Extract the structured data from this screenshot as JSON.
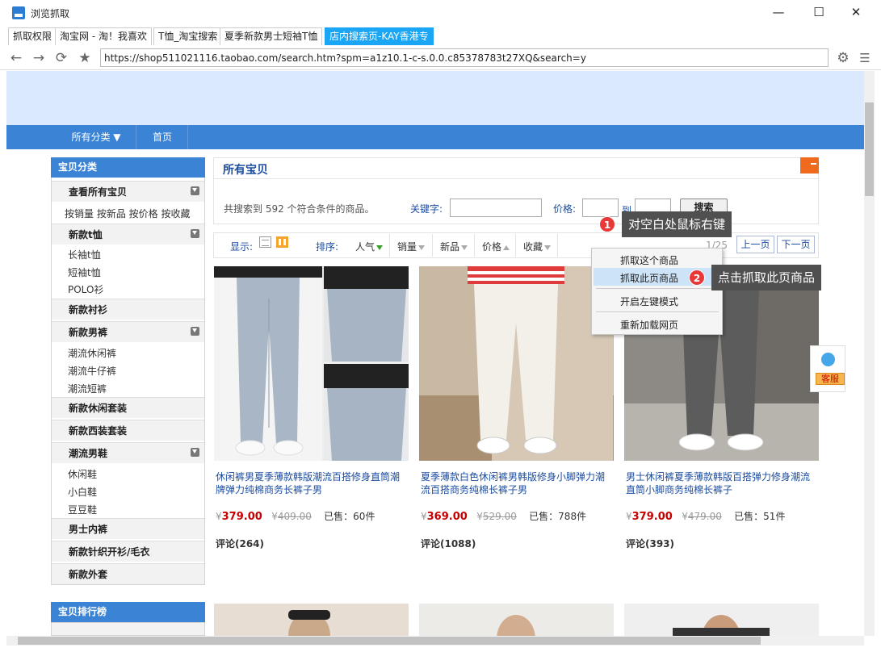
{
  "window": {
    "title": "浏览抓取",
    "min": "—",
    "max": "☐",
    "close": "✕"
  },
  "tabs": [
    {
      "label": "抓取权限"
    },
    {
      "label": "淘宝网 - 淘！我喜欢"
    },
    {
      "label": "T恤_淘宝搜索"
    },
    {
      "label": "夏季新款男士短袖T恤"
    },
    {
      "label": "店内搜索页-KAY香港专"
    }
  ],
  "toolbar": {
    "url": "https://shop511021116.taobao.com/search.htm?spm=a1z10.1-c-s.0.0.c85378783t27XQ&search=y"
  },
  "nav": {
    "all_categories": "所有分类",
    "home": "首页"
  },
  "sidebar": {
    "title": "宝贝分类",
    "view_all": "查看所有宝贝",
    "sort_links": "按销量 按新品 按价格 按收藏",
    "categories": [
      {
        "name": "新款t恤",
        "subs": [
          "长袖t恤",
          "短袖t恤",
          "POLO衫"
        ]
      },
      {
        "name": "新款衬衫",
        "subs": []
      },
      {
        "name": "新款男裤",
        "subs": [
          "潮流休闲裤",
          "潮流牛仔裤",
          "潮流短裤"
        ]
      },
      {
        "name": "新款休闲套装",
        "subs": []
      },
      {
        "name": "新款西装套装",
        "subs": []
      },
      {
        "name": "潮流男鞋",
        "subs": [
          "休闲鞋",
          "小白鞋",
          "豆豆鞋"
        ]
      },
      {
        "name": "男士内裤",
        "subs": []
      },
      {
        "name": "新款针织开衫/毛衣",
        "subs": []
      },
      {
        "name": "新款外套",
        "subs": []
      }
    ],
    "ranking_title": "宝贝排行榜"
  },
  "search_panel": {
    "title": "所有宝贝",
    "result_text": "共搜索到 592 个符合条件的商品。",
    "keyword_label": "关键字:",
    "price_label": "价格:",
    "to_label": "到",
    "search_button": "搜索"
  },
  "sort_bar": {
    "display_label": "显示:",
    "sort_label": "排序:",
    "items": [
      "人气",
      "销量",
      "新品",
      "价格",
      "收藏"
    ],
    "page_indicator": "1/25",
    "prev": "上一页",
    "next": "下一页"
  },
  "products": [
    {
      "title": "休闲裤男夏季薄款韩版潮流百搭修身直筒潮牌弹力纯棉商务长裤子男",
      "price": "379.00",
      "original": "409.00",
      "sold": "已售：60件",
      "reviews": "评论(264)",
      "currency": "¥"
    },
    {
      "title": "夏季薄款白色休闲裤男韩版修身小脚弹力潮流百搭商务纯棉长裤子男",
      "price": "369.00",
      "original": "529.00",
      "sold": "已售：788件",
      "reviews": "评论(1088)",
      "currency": "¥"
    },
    {
      "title": "男士休闲裤夏季薄款韩版百搭弹力修身潮流直筒小脚商务纯棉长裤子",
      "price": "379.00",
      "original": "479.00",
      "sold": "已售：51件",
      "reviews": "评论(393)",
      "currency": "¥"
    }
  ],
  "context_menu": {
    "items": [
      "抓取这个商品",
      "抓取此页商品",
      "开启左键模式",
      "重新加载网页"
    ]
  },
  "callouts": [
    {
      "number": "1",
      "text": "对空白处鼠标右键"
    },
    {
      "number": "2",
      "text": "点击抓取此页商品"
    }
  ],
  "service": {
    "label": "客服"
  },
  "colors": {
    "accent_blue": "#3a83d5",
    "active_tab": "#1aa5f5",
    "price_red": "#c40000",
    "banner": "#dae9fe",
    "callout_bg": "#505050",
    "bubble_red": "#e83838"
  }
}
